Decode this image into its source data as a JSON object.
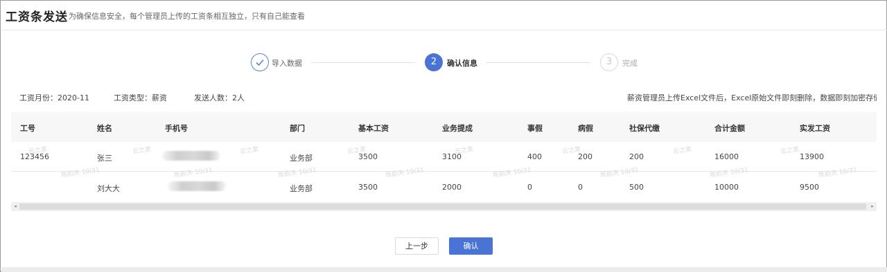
{
  "header": {
    "title": "工资条发送",
    "subtitle": "为确保信息安全，每个管理员上传的工资条相互独立，只有自己能查看"
  },
  "steps": [
    {
      "label": "导入数据",
      "number": "✓",
      "state": "done"
    },
    {
      "label": "确认信息",
      "number": "2",
      "state": "active"
    },
    {
      "label": "完成",
      "number": "3",
      "state": "pending"
    }
  ],
  "meta": {
    "month": "工资月份：2020-11",
    "type": "工资类型：薪资",
    "count": "发送人数：2人",
    "notice": "薪资管理员上传Excel文件后，Excel原始文件即刻删除，数据即刻加密存储"
  },
  "table": {
    "columns": [
      "工号",
      "姓名",
      "手机号",
      "部门",
      "基本工资",
      "业务提成",
      "事假",
      "病假",
      "社保代缴",
      "合计金额",
      "实发工资"
    ],
    "rows": [
      [
        "123456",
        "张三",
        "",
        "业务部",
        "3500",
        "3100",
        "400",
        "200",
        "200",
        "16000",
        "13900"
      ],
      [
        "",
        "刘大大",
        "",
        "业务部",
        "3500",
        "2000",
        "0",
        "0",
        "500",
        "10000",
        "9500"
      ]
    ]
  },
  "watermark": {
    "a": "云之家",
    "b": "陈韵天 10/31"
  },
  "scroll": {
    "left_arrow": "◂",
    "right_arrow": "▸"
  },
  "buttons": {
    "prev": "上一步",
    "confirm": "确认"
  },
  "colors": {
    "primary": "#4a73d6",
    "border": "#e8e8e8",
    "header_bg": "#f7f7f7"
  }
}
